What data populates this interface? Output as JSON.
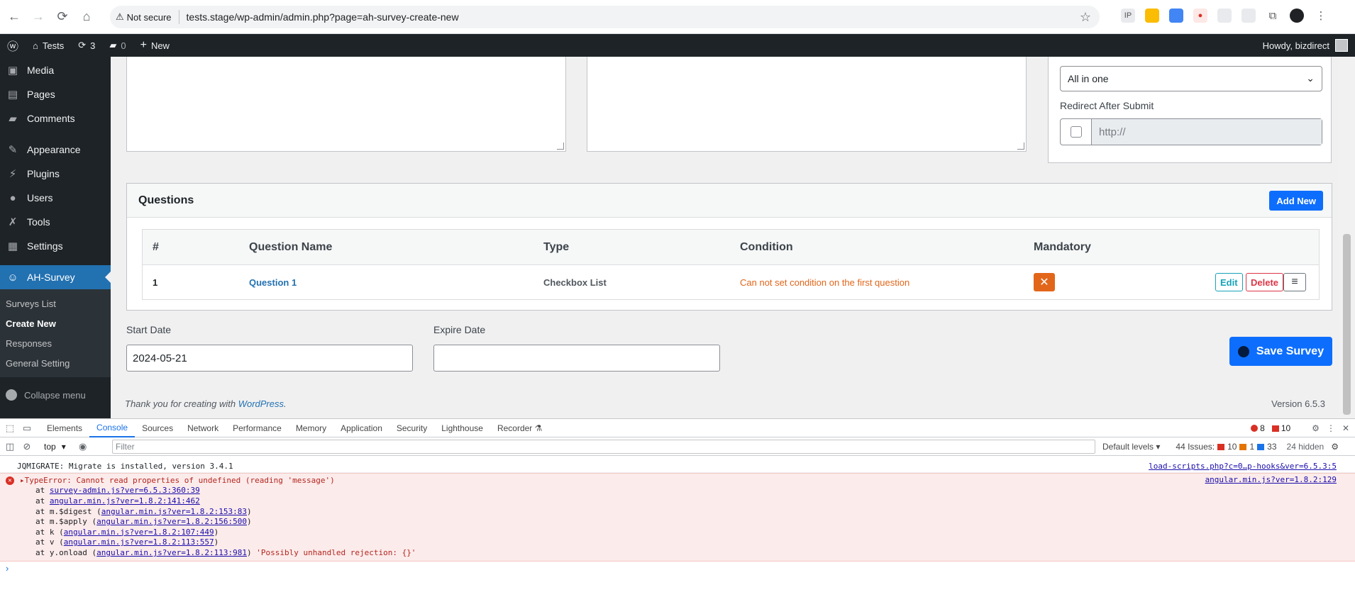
{
  "browser": {
    "security_label": "Not secure",
    "url": "tests.stage/wp-admin/admin.php?page=ah-survey-create-new"
  },
  "adminbar": {
    "site_name": "Tests",
    "updates_count": "3",
    "comments_count": "0",
    "new_label": "New",
    "howdy": "Howdy, bizdirect"
  },
  "sidebar": {
    "items": [
      {
        "label": "Media",
        "icon": "media-icon"
      },
      {
        "label": "Pages",
        "icon": "pages-icon"
      },
      {
        "label": "Comments",
        "icon": "comments-icon"
      },
      {
        "label": "Appearance",
        "icon": "appearance-icon"
      },
      {
        "label": "Plugins",
        "icon": "plugins-icon"
      },
      {
        "label": "Users",
        "icon": "users-icon"
      },
      {
        "label": "Tools",
        "icon": "tools-icon"
      },
      {
        "label": "Settings",
        "icon": "settings-icon"
      },
      {
        "label": "AH-Survey",
        "icon": "survey-icon"
      }
    ],
    "submenu": [
      "Surveys List",
      "Create New",
      "Responses",
      "General Setting"
    ],
    "collapse_label": "Collapse menu"
  },
  "survey_settings": {
    "view_select_value": "All in one",
    "redirect_label": "Redirect After Submit",
    "redirect_placeholder": "http://"
  },
  "questions": {
    "title": "Questions",
    "add_new_label": "Add New",
    "columns": [
      "#",
      "Question Name",
      "Type",
      "Condition",
      "Mandatory"
    ],
    "rows": [
      {
        "num": "1",
        "name": "Question 1",
        "type": "Checkbox List",
        "condition": "Can not set condition on the first question"
      }
    ],
    "edit_label": "Edit",
    "delete_label": "Delete"
  },
  "dates": {
    "start_label": "Start Date",
    "start_value": "2024-05-21",
    "expire_label": "Expire Date",
    "expire_value": ""
  },
  "save_label": "Save Survey",
  "footer": {
    "thanks_prefix": "Thank you for creating with ",
    "wp_link": "WordPress",
    "thanks_suffix": ".",
    "version": "Version 6.5.3"
  },
  "devtools": {
    "tabs": [
      "Elements",
      "Console",
      "Sources",
      "Network",
      "Performance",
      "Memory",
      "Application",
      "Security",
      "Lighthouse",
      "Recorder"
    ],
    "active_tab": "Console",
    "error_count": "8",
    "warning_count": "10",
    "context": "top",
    "filter_placeholder": "Filter",
    "levels": "Default levels",
    "issues_label": "44 Issues:",
    "issues_errors": "10",
    "issues_warnings": "1",
    "issues_info": "33",
    "hidden": "24 hidden",
    "log_message": "JQMIGRATE: Migrate is installed, version 3.4.1",
    "log_source": "load-scripts.php?c=0…p-hooks&ver=6.5.3:5",
    "error_title": "TypeError: Cannot read properties of undefined (reading 'message')",
    "error_source": "angular.min.js?ver=1.8.2:129",
    "stack": [
      {
        "prefix": "at ",
        "link": "survey-admin.js?ver=6.5.3:360:39",
        "suffix": ""
      },
      {
        "prefix": "at ",
        "link": "angular.min.js?ver=1.8.2:141:462",
        "suffix": ""
      },
      {
        "prefix": "at m.$digest (",
        "link": "angular.min.js?ver=1.8.2:153:83",
        "suffix": ")"
      },
      {
        "prefix": "at m.$apply (",
        "link": "angular.min.js?ver=1.8.2:156:500",
        "suffix": ")"
      },
      {
        "prefix": "at k (",
        "link": "angular.min.js?ver=1.8.2:107:449",
        "suffix": ")"
      },
      {
        "prefix": "at v (",
        "link": "angular.min.js?ver=1.8.2:113:557",
        "suffix": ")"
      },
      {
        "prefix": "at y.onload (",
        "link": "angular.min.js?ver=1.8.2:113:981",
        "suffix": ")"
      }
    ],
    "rejection_text": "'Possibly unhandled rejection: {}'"
  }
}
